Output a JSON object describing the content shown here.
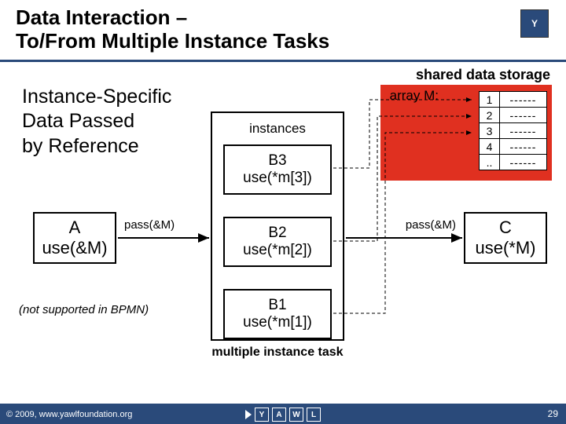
{
  "title": {
    "line1": "Data Interaction –",
    "line2": "To/From Multiple Instance Tasks"
  },
  "logo_top": "Y",
  "shared_storage_label": "shared data storage",
  "subtitle": {
    "l1": "Instance-Specific",
    "l2": "Data Passed",
    "l3": "by Reference"
  },
  "array_label": "array M:",
  "table_rows": [
    {
      "idx": "1",
      "val": "------"
    },
    {
      "idx": "2",
      "val": "------"
    },
    {
      "idx": "3",
      "val": "------"
    },
    {
      "idx": "4",
      "val": "------"
    },
    {
      "idx": "..",
      "val": "------"
    }
  ],
  "instances_label": "instances",
  "b_nodes": [
    {
      "l1": "B3",
      "l2": "use(*m[3])"
    },
    {
      "l1": "B2",
      "l2": "use(*m[2])"
    },
    {
      "l1": "B1",
      "l2": "use(*m[1])"
    }
  ],
  "mi_caption": "multiple instance task",
  "nodeA": {
    "l1": "A",
    "l2": "use(&M)"
  },
  "nodeC": {
    "l1": "C",
    "l2": "use(*M)"
  },
  "pass_left": "pass(&M)",
  "pass_right": "pass(&M)",
  "bpmn_note": "(not supported in BPMN)",
  "footer": {
    "copyright": "© 2009, www.yawlfoundation.org",
    "page": "29",
    "logo_letters": [
      "Y",
      "A",
      "W",
      "L"
    ]
  },
  "chart_data": {
    "type": "diagram",
    "title": "Data Interaction – To/From Multiple Instance Tasks",
    "subtitle": "Instance-Specific Data Passed by Reference",
    "shared_storage": {
      "label": "shared data storage",
      "array_name": "M",
      "rows": [
        "1",
        "2",
        "3",
        "4",
        ".."
      ]
    },
    "tasks": {
      "A": {
        "expr": "use(&M)",
        "out_edge_label": "pass(&M)",
        "to": "MI"
      },
      "MI": {
        "label": "multiple instance task",
        "instances": [
          {
            "name": "B1",
            "expr": "use(*m[1])",
            "reads_row": 1
          },
          {
            "name": "B2",
            "expr": "use(*m[2])",
            "reads_row": 2
          },
          {
            "name": "B3",
            "expr": "use(*m[3])",
            "reads_row": 3
          }
        ],
        "out_edge_label": "pass(&M)",
        "to": "C"
      },
      "C": {
        "expr": "use(*M)"
      }
    },
    "note": "(not supported in BPMN)"
  }
}
